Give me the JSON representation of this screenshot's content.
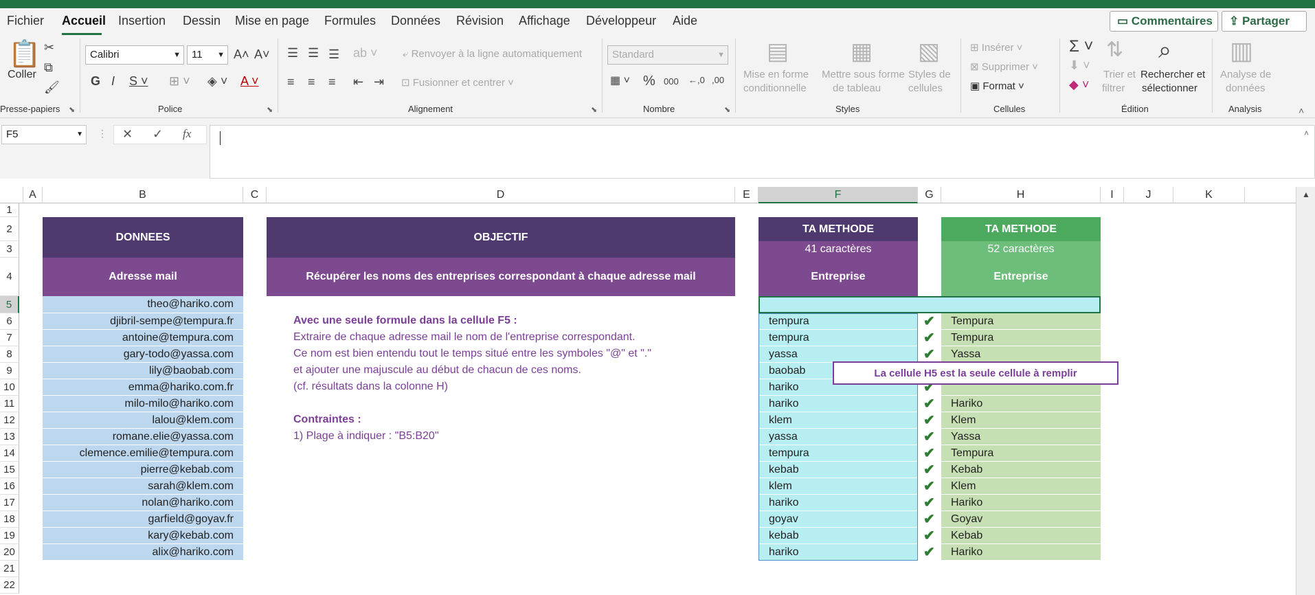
{
  "menu": {
    "tabs": [
      "Fichier",
      "Accueil",
      "Insertion",
      "Dessin",
      "Mise en page",
      "Formules",
      "Données",
      "Révision",
      "Affichage",
      "Développeur",
      "Aide"
    ],
    "comments_label": "Commentaires",
    "share_label": "Partager"
  },
  "ribbon": {
    "paste_label": "Coller",
    "clipboard_group": "Presse-papiers",
    "font_name": "Calibri",
    "font_size": "11",
    "font_group": "Police",
    "wrap_text": "Renvoyer à la ligne automatiquement",
    "merge_center": "Fusionner et centrer",
    "alignment_group": "Alignement",
    "number_format": "Standard",
    "number_group": "Nombre",
    "cond_format_1": "Mise en forme",
    "cond_format_2": "conditionnelle",
    "table_format_1": "Mettre sous forme",
    "table_format_2": "de tableau",
    "cell_styles_1": "Styles de",
    "cell_styles_2": "cellules",
    "styles_group": "Styles",
    "insert_label": "Insérer",
    "delete_label": "Supprimer",
    "format_label": "Format",
    "cells_group": "Cellules",
    "sort_1": "Trier et",
    "sort_2": "filtrer",
    "find_1": "Rechercher et",
    "find_2": "sélectionner",
    "editing_group": "Édition",
    "analyze_1": "Analyse de",
    "analyze_2": "données",
    "analysis_group": "Analysis"
  },
  "formula_bar": {
    "name_box": "F5",
    "fx": "fx"
  },
  "columns": [
    "A",
    "B",
    "C",
    "D",
    "E",
    "F",
    "G",
    "H",
    "I",
    "J",
    "K"
  ],
  "rows": [
    "1",
    "2",
    "3",
    "4",
    "5",
    "6",
    "7",
    "8",
    "9",
    "10",
    "11",
    "12",
    "13",
    "14",
    "15",
    "16",
    "17",
    "18",
    "19",
    "20",
    "21",
    "22"
  ],
  "sheet": {
    "donnees_header": "DONNEES",
    "email_header": "Adresse mail",
    "objectif_header": "OBJECTIF",
    "objectif_sub": "Récupérer les noms des entreprises correspondant à chaque adresse mail",
    "method_f_header": "TA METHODE",
    "method_f_count": "41 caractères",
    "method_f_col": "Entreprise",
    "method_h_header": "TA METHODE",
    "method_h_count": "52 caractères",
    "method_h_col": "Entreprise",
    "instructions": [
      "Avec une seule formule dans la cellule F5 :",
      "Extraire de chaque adresse mail le nom de l'entreprise correspondant.",
      "Ce nom est bien entendu tout le temps situé entre les symboles \"@\" et \".\"",
      "et ajouter une majuscule au début de chacun de ces noms.",
      "(cf. résultats dans la colonne H)",
      "",
      "Contraintes :",
      "1) Plage à indiquer : \"B5:B20\""
    ],
    "callout": "La cellule H5 est la seule cellule à remplir",
    "emails": [
      "theo@hariko.com",
      "djibril-sempe@tempura.fr",
      "antoine@tempura.com",
      "gary-todo@yassa.com",
      "lily@baobab.com",
      "emma@hariko.com.fr",
      "milo-milo@hariko.com",
      "lalou@klem.com",
      "romane.elie@yassa.com",
      "clemence.emilie@tempura.com",
      "pierre@kebab.com",
      "sarah@klem.com",
      "nolan@hariko.com",
      "garfield@goyav.fr",
      "kary@kebab.com",
      "alix@hariko.com"
    ],
    "f_values": [
      "",
      "tempura",
      "tempura",
      "yassa",
      "baobab",
      "hariko",
      "hariko",
      "klem",
      "yassa",
      "tempura",
      "kebab",
      "klem",
      "hariko",
      "goyav",
      "kebab",
      "hariko"
    ],
    "h_values": [
      "",
      "Tempura",
      "Tempura",
      "Yassa",
      "",
      "",
      "Hariko",
      "Klem",
      "Yassa",
      "Tempura",
      "Kebab",
      "Klem",
      "Hariko",
      "Goyav",
      "Kebab",
      "Hariko"
    ],
    "check_glyph": "✔"
  }
}
